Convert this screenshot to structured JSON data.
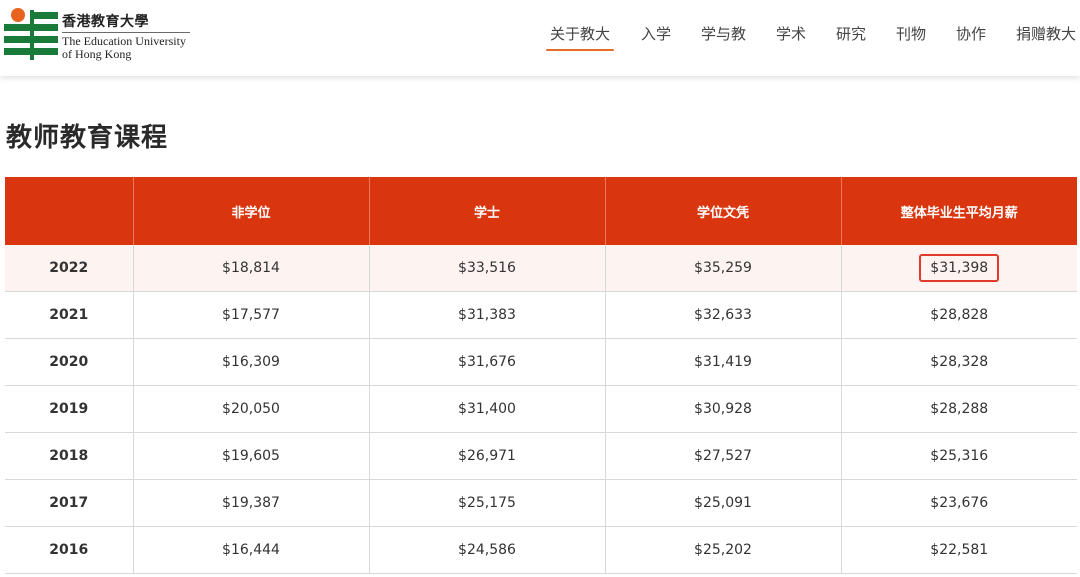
{
  "header": {
    "logo": {
      "name_cn": "香港教育大學",
      "name_en_line1": "The Education University",
      "name_en_line2": "of Hong Kong"
    },
    "nav": [
      {
        "label": "关于教大",
        "active": true
      },
      {
        "label": "入学",
        "active": false
      },
      {
        "label": "学与教",
        "active": false
      },
      {
        "label": "学术",
        "active": false
      },
      {
        "label": "研究",
        "active": false
      },
      {
        "label": "刊物",
        "active": false
      },
      {
        "label": "协作",
        "active": false
      },
      {
        "label": "捐赠教大",
        "active": false
      }
    ]
  },
  "page_title": "教师教育课程",
  "table": {
    "columns": [
      "",
      "非学位",
      "学士",
      "学位文凭",
      "整体毕业生平均月薪"
    ],
    "rows": [
      {
        "year": "2022",
        "non_degree": "$18,814",
        "bachelor": "$33,516",
        "pgde": "$35,259",
        "overall": "$31,398"
      },
      {
        "year": "2021",
        "non_degree": "$17,577",
        "bachelor": "$31,383",
        "pgde": "$32,633",
        "overall": "$28,828"
      },
      {
        "year": "2020",
        "non_degree": "$16,309",
        "bachelor": "$31,676",
        "pgde": "$31,419",
        "overall": "$28,328"
      },
      {
        "year": "2019",
        "non_degree": "$20,050",
        "bachelor": "$31,400",
        "pgde": "$30,928",
        "overall": "$28,288"
      },
      {
        "year": "2018",
        "non_degree": "$19,605",
        "bachelor": "$26,971",
        "pgde": "$27,527",
        "overall": "$25,316"
      },
      {
        "year": "2017",
        "non_degree": "$19,387",
        "bachelor": "$25,175",
        "pgde": "$25,091",
        "overall": "$23,676"
      },
      {
        "year": "2016",
        "non_degree": "$16,444",
        "bachelor": "$24,586",
        "pgde": "$25,202",
        "overall": "$22,581"
      }
    ]
  },
  "colors": {
    "header_red": "#d9360f",
    "nav_underline": "#e46d2a",
    "highlight_border": "#e03a2e",
    "logo_green": "#1a7a3a",
    "logo_orange": "#e8641e"
  }
}
